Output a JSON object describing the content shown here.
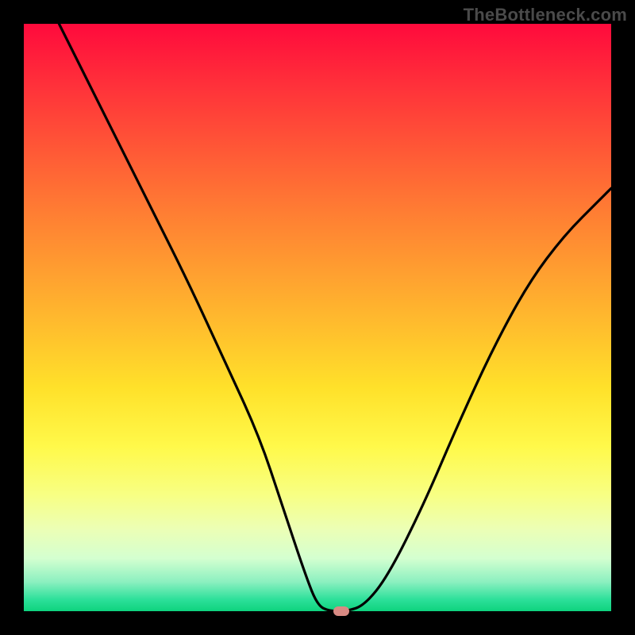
{
  "watermark": "TheBottleneck.com",
  "chart_data": {
    "type": "line",
    "title": "",
    "xlabel": "",
    "ylabel": "",
    "xlim": [
      0,
      100
    ],
    "ylim": [
      0,
      100
    ],
    "grid": false,
    "legend": false,
    "series": [
      {
        "name": "bottleneck-curve",
        "x": [
          6,
          12,
          18,
          22,
          28,
          34,
          40,
          44,
          48,
          50,
          52,
          55,
          58,
          62,
          68,
          74,
          80,
          86,
          92,
          98,
          100
        ],
        "values": [
          100,
          88,
          76,
          68,
          56,
          43,
          30,
          18,
          6,
          1,
          0,
          0,
          1,
          6,
          18,
          32,
          45,
          56,
          64,
          70,
          72
        ]
      }
    ],
    "marker": {
      "x": 54,
      "y": 0,
      "color": "#d88a83"
    },
    "background_gradient": {
      "type": "vertical",
      "stops": [
        {
          "pos": 0.0,
          "color": "#ff0a3c"
        },
        {
          "pos": 0.5,
          "color": "#ffbf2d"
        },
        {
          "pos": 0.8,
          "color": "#f8ff82"
        },
        {
          "pos": 1.0,
          "color": "#0ed37e"
        }
      ]
    }
  }
}
